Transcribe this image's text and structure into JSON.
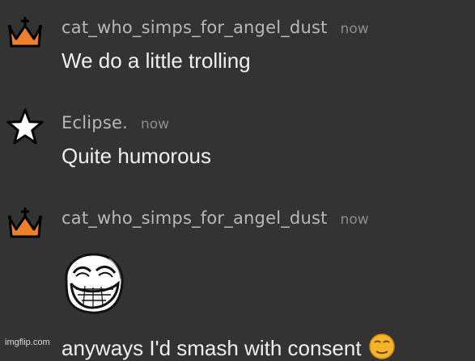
{
  "colors": {
    "background": "#333333",
    "crown": "#ef7f2b",
    "username": "#b8b8b8",
    "timestamp": "#8d8d8d",
    "message": "#efefef"
  },
  "messages": [
    {
      "username": "cat_who_simps_for_angel_dust",
      "time": "now",
      "text": "We do a little trolling",
      "avatar_icon": "orange-crown-icon"
    },
    {
      "username": "Eclipse.",
      "time": "now",
      "text": "Quite humorous",
      "avatar_icon": "white-star-icon"
    },
    {
      "username": "cat_who_simps_for_angel_dust",
      "time": "now",
      "image_icon": "trollface-icon",
      "text": "anyways I'd smash with consent",
      "emoji_icon": "relieved-face-emoji-icon"
    }
  ],
  "watermark": "imgflip.com"
}
